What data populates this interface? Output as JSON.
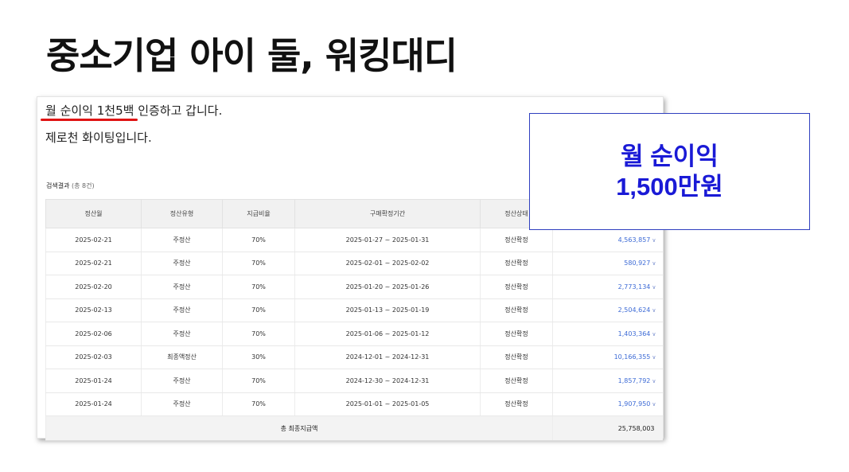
{
  "slide": {
    "title": "중소기업 아이 둘, 워킹대디"
  },
  "post": {
    "line1_highlight": "월 순이익 1천5백",
    "line1_rest": " 인증하고 갑니다.",
    "line2": "제로천 화이팅입니다."
  },
  "results": {
    "title": "검색결과",
    "count": "(총 8건)",
    "columns": [
      "정산월",
      "정산유형",
      "지급비율",
      "구매확정기간",
      "정산상태",
      ""
    ],
    "rows": [
      [
        "2025-02-21",
        "주정산",
        "70%",
        "2025-01-27 ~ 2025-01-31",
        "정산확정",
        "4,563,857"
      ],
      [
        "2025-02-21",
        "주정산",
        "70%",
        "2025-02-01 ~ 2025-02-02",
        "정산확정",
        "580,927"
      ],
      [
        "2025-02-20",
        "주정산",
        "70%",
        "2025-01-20 ~ 2025-01-26",
        "정산확정",
        "2,773,134"
      ],
      [
        "2025-02-13",
        "주정산",
        "70%",
        "2025-01-13 ~ 2025-01-19",
        "정산확정",
        "2,504,624"
      ],
      [
        "2025-02-06",
        "주정산",
        "70%",
        "2025-01-06 ~ 2025-01-12",
        "정산확정",
        "1,403,364"
      ],
      [
        "2025-02-03",
        "최종액정산",
        "30%",
        "2024-12-01 ~ 2024-12-31",
        "정산확정",
        "10,166,355"
      ],
      [
        "2025-01-24",
        "주정산",
        "70%",
        "2024-12-30 ~ 2024-12-31",
        "정산확정",
        "1,857,792"
      ],
      [
        "2025-01-24",
        "주정산",
        "70%",
        "2025-01-01 ~ 2025-01-05",
        "정산확정",
        "1,907,950"
      ]
    ],
    "total_label": "총 최종지급액",
    "total_value": "25,758,003",
    "expand_icon": "chevron-down-icon"
  },
  "callout": {
    "line1": "월 순이익",
    "line2": "1,500만원"
  },
  "colors": {
    "underline": "#e01414",
    "callout_text": "#1a1ad6",
    "callout_border": "#2f3fbf",
    "amount_link": "#3d6bd6"
  }
}
